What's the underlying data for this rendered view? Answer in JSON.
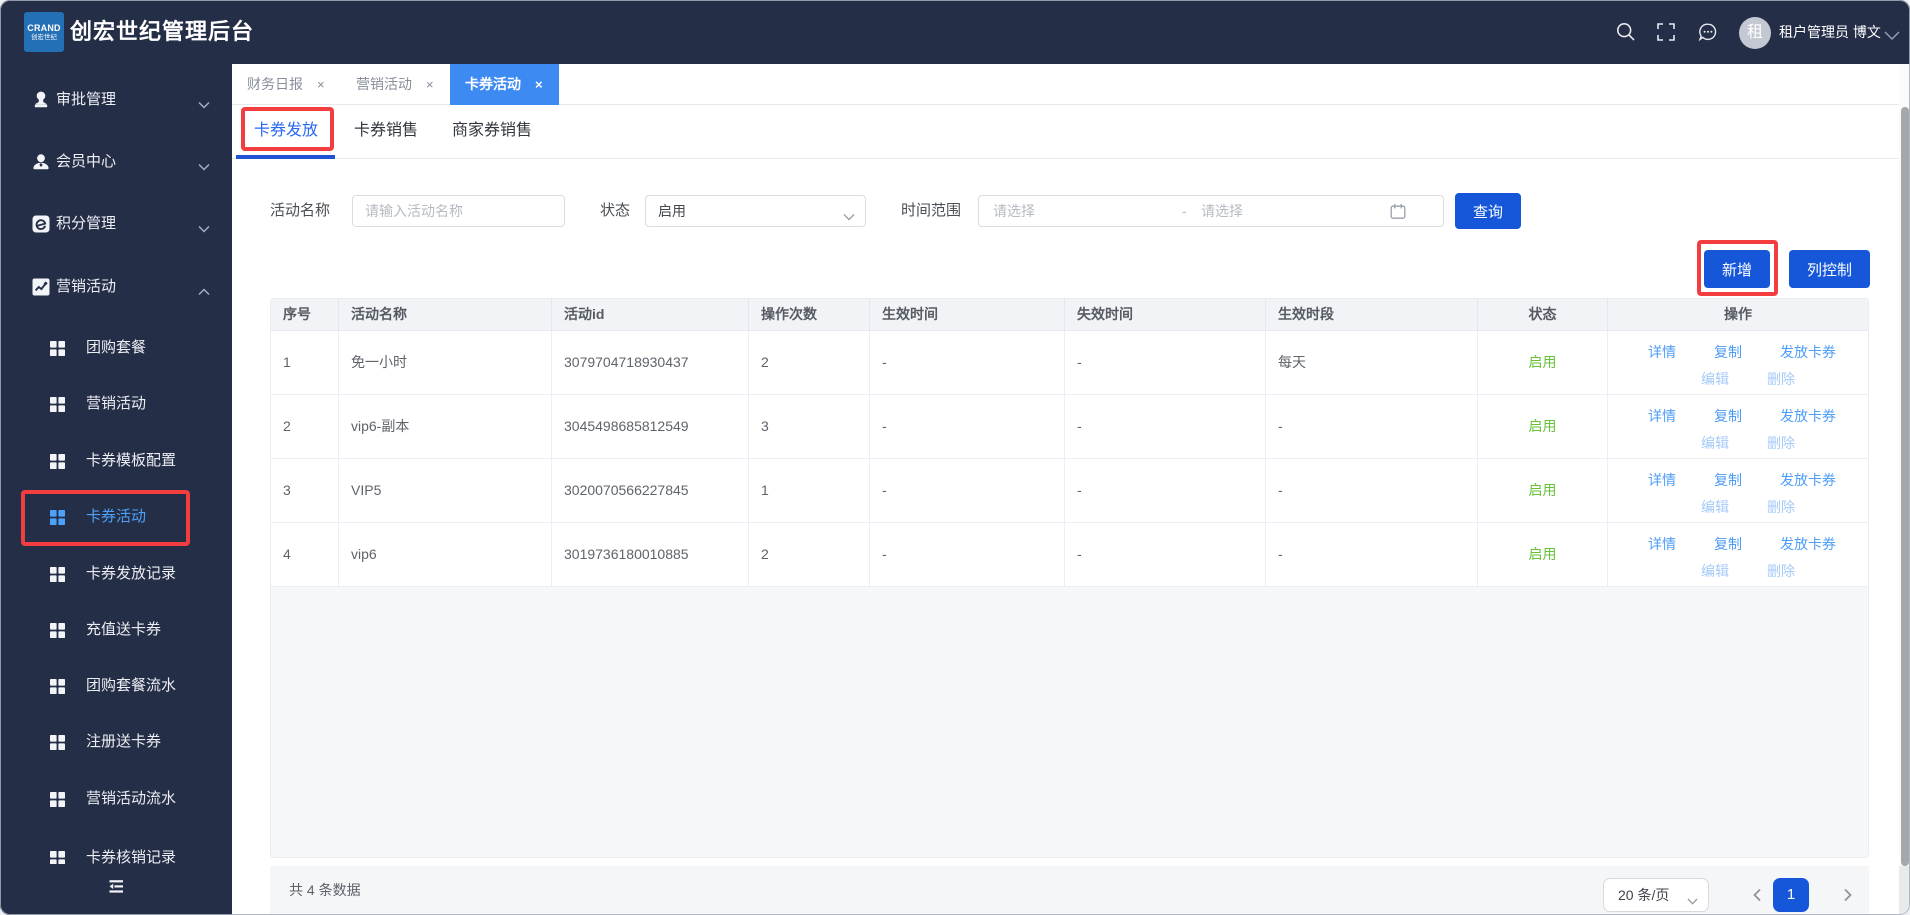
{
  "topbar": {
    "logo_title": "CRAND",
    "logo_subtitle": "创宏世纪",
    "title": "创宏世纪管理后台",
    "avatar_char": "租",
    "user_name": "租户管理员 博文"
  },
  "sidebar": {
    "items": [
      {
        "label": "审批管理"
      },
      {
        "label": "会员中心"
      },
      {
        "label": "积分管理"
      },
      {
        "label": "营销活动"
      }
    ],
    "submenu": [
      {
        "label": "团购套餐"
      },
      {
        "label": "营销活动"
      },
      {
        "label": "卡券模板配置"
      },
      {
        "label": "卡券活动",
        "active": true
      },
      {
        "label": "卡券发放记录"
      },
      {
        "label": "充值送卡券"
      },
      {
        "label": "团购套餐流水"
      },
      {
        "label": "注册送卡券"
      },
      {
        "label": "营销活动流水"
      },
      {
        "label": "卡券核销记录"
      }
    ]
  },
  "tabs": [
    {
      "label": "财务日报",
      "close": "×"
    },
    {
      "label": "营销活动",
      "close": "×"
    },
    {
      "label": "卡券活动",
      "close": "×",
      "active": true
    }
  ],
  "subtabs": [
    {
      "label": "卡券发放",
      "active": true
    },
    {
      "label": "卡券销售"
    },
    {
      "label": "商家券销售"
    }
  ],
  "filters": {
    "name_label": "活动名称",
    "name_placeholder": "请输入活动名称",
    "status_label": "状态",
    "status_value": "启用",
    "time_label": "时间范围",
    "time_start_placeholder": "请选择",
    "time_separator": "-",
    "time_end_placeholder": "请选择",
    "search_button": "查询"
  },
  "actions": {
    "add": "新增",
    "columns": "列控制"
  },
  "table": {
    "headers": [
      "序号",
      "活动名称",
      "活动id",
      "操作次数",
      "生效时间",
      "失效时间",
      "生效时段",
      "状态",
      "操作"
    ],
    "rows": [
      {
        "index": "1",
        "name": "免一小时",
        "id": "3079704718930437",
        "count": "2",
        "start": "-",
        "end": "-",
        "period": "每天",
        "status": "启用"
      },
      {
        "index": "2",
        "name": "vip6-副本",
        "id": "3045498685812549",
        "count": "3",
        "start": "-",
        "end": "-",
        "period": "-",
        "status": "启用"
      },
      {
        "index": "3",
        "name": "VIP5",
        "id": "3020070566227845",
        "count": "1",
        "start": "-",
        "end": "-",
        "period": "-",
        "status": "启用"
      },
      {
        "index": "4",
        "name": "vip6",
        "id": "3019736180010885",
        "count": "2",
        "start": "-",
        "end": "-",
        "period": "-",
        "status": "启用"
      }
    ],
    "ops": [
      "详情",
      "复制",
      "发放卡券"
    ],
    "ops2": [
      "编辑",
      "删除"
    ]
  },
  "footer": {
    "total": "共 4 条数据",
    "page_size": "20 条/页",
    "current_page": "1"
  },
  "colors": {
    "navy": "#252e47",
    "primary": "#1657da",
    "tab_active": "#3d8bf2",
    "subtab_active": "#2968f3",
    "link": "#4e9df6",
    "link_light": "#a5c9fa",
    "green": "#67c23a",
    "annotation_red": "#f23e3e",
    "sidebar_active": "#4da1fa",
    "logo_blue": "#2470b6"
  }
}
